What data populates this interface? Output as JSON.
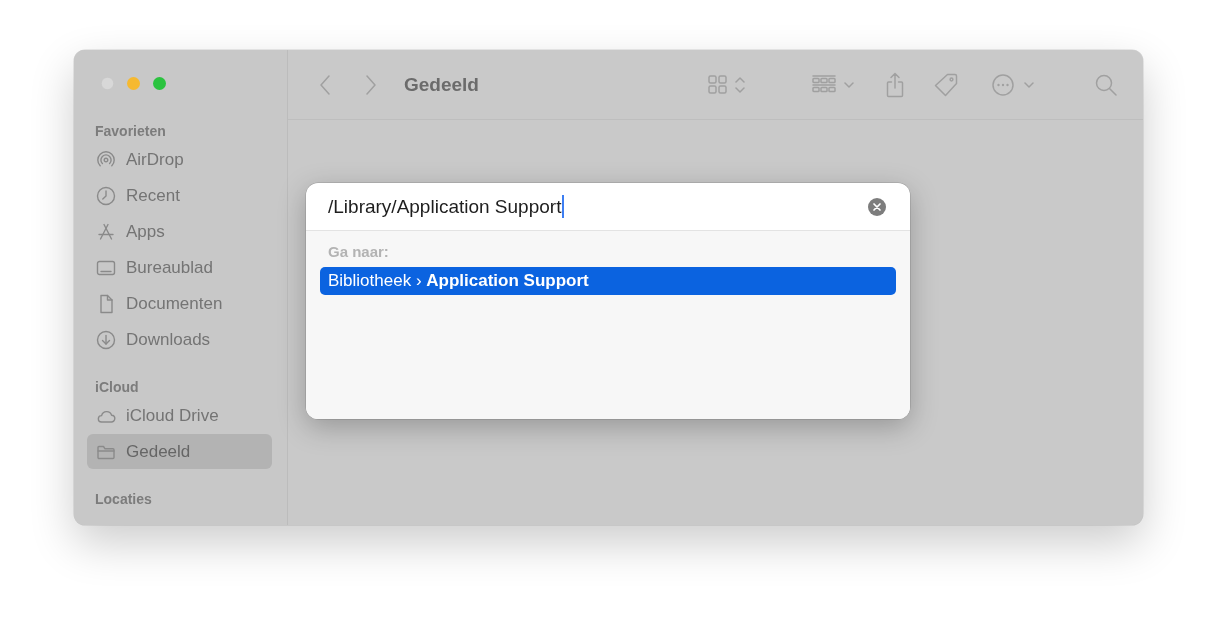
{
  "window": {
    "title": "Gedeeld"
  },
  "sidebar": {
    "sections": [
      {
        "heading": "Favorieten",
        "items": [
          {
            "label": "AirDrop",
            "selected": false
          },
          {
            "label": "Recent",
            "selected": false
          },
          {
            "label": "Apps",
            "selected": false
          },
          {
            "label": "Bureaublad",
            "selected": false
          },
          {
            "label": "Documenten",
            "selected": false
          },
          {
            "label": "Downloads",
            "selected": false
          }
        ]
      },
      {
        "heading": "iCloud",
        "items": [
          {
            "label": "iCloud Drive",
            "selected": false
          },
          {
            "label": "Gedeeld",
            "selected": true
          }
        ]
      },
      {
        "heading": "Locaties"
      }
    ]
  },
  "go_to_folder": {
    "path": "/Library/Application Support",
    "suggestions_heading": "Ga naar:",
    "suggestions": [
      {
        "text": "Bibliotheek › **Application Support**",
        "selected": true
      }
    ]
  }
}
